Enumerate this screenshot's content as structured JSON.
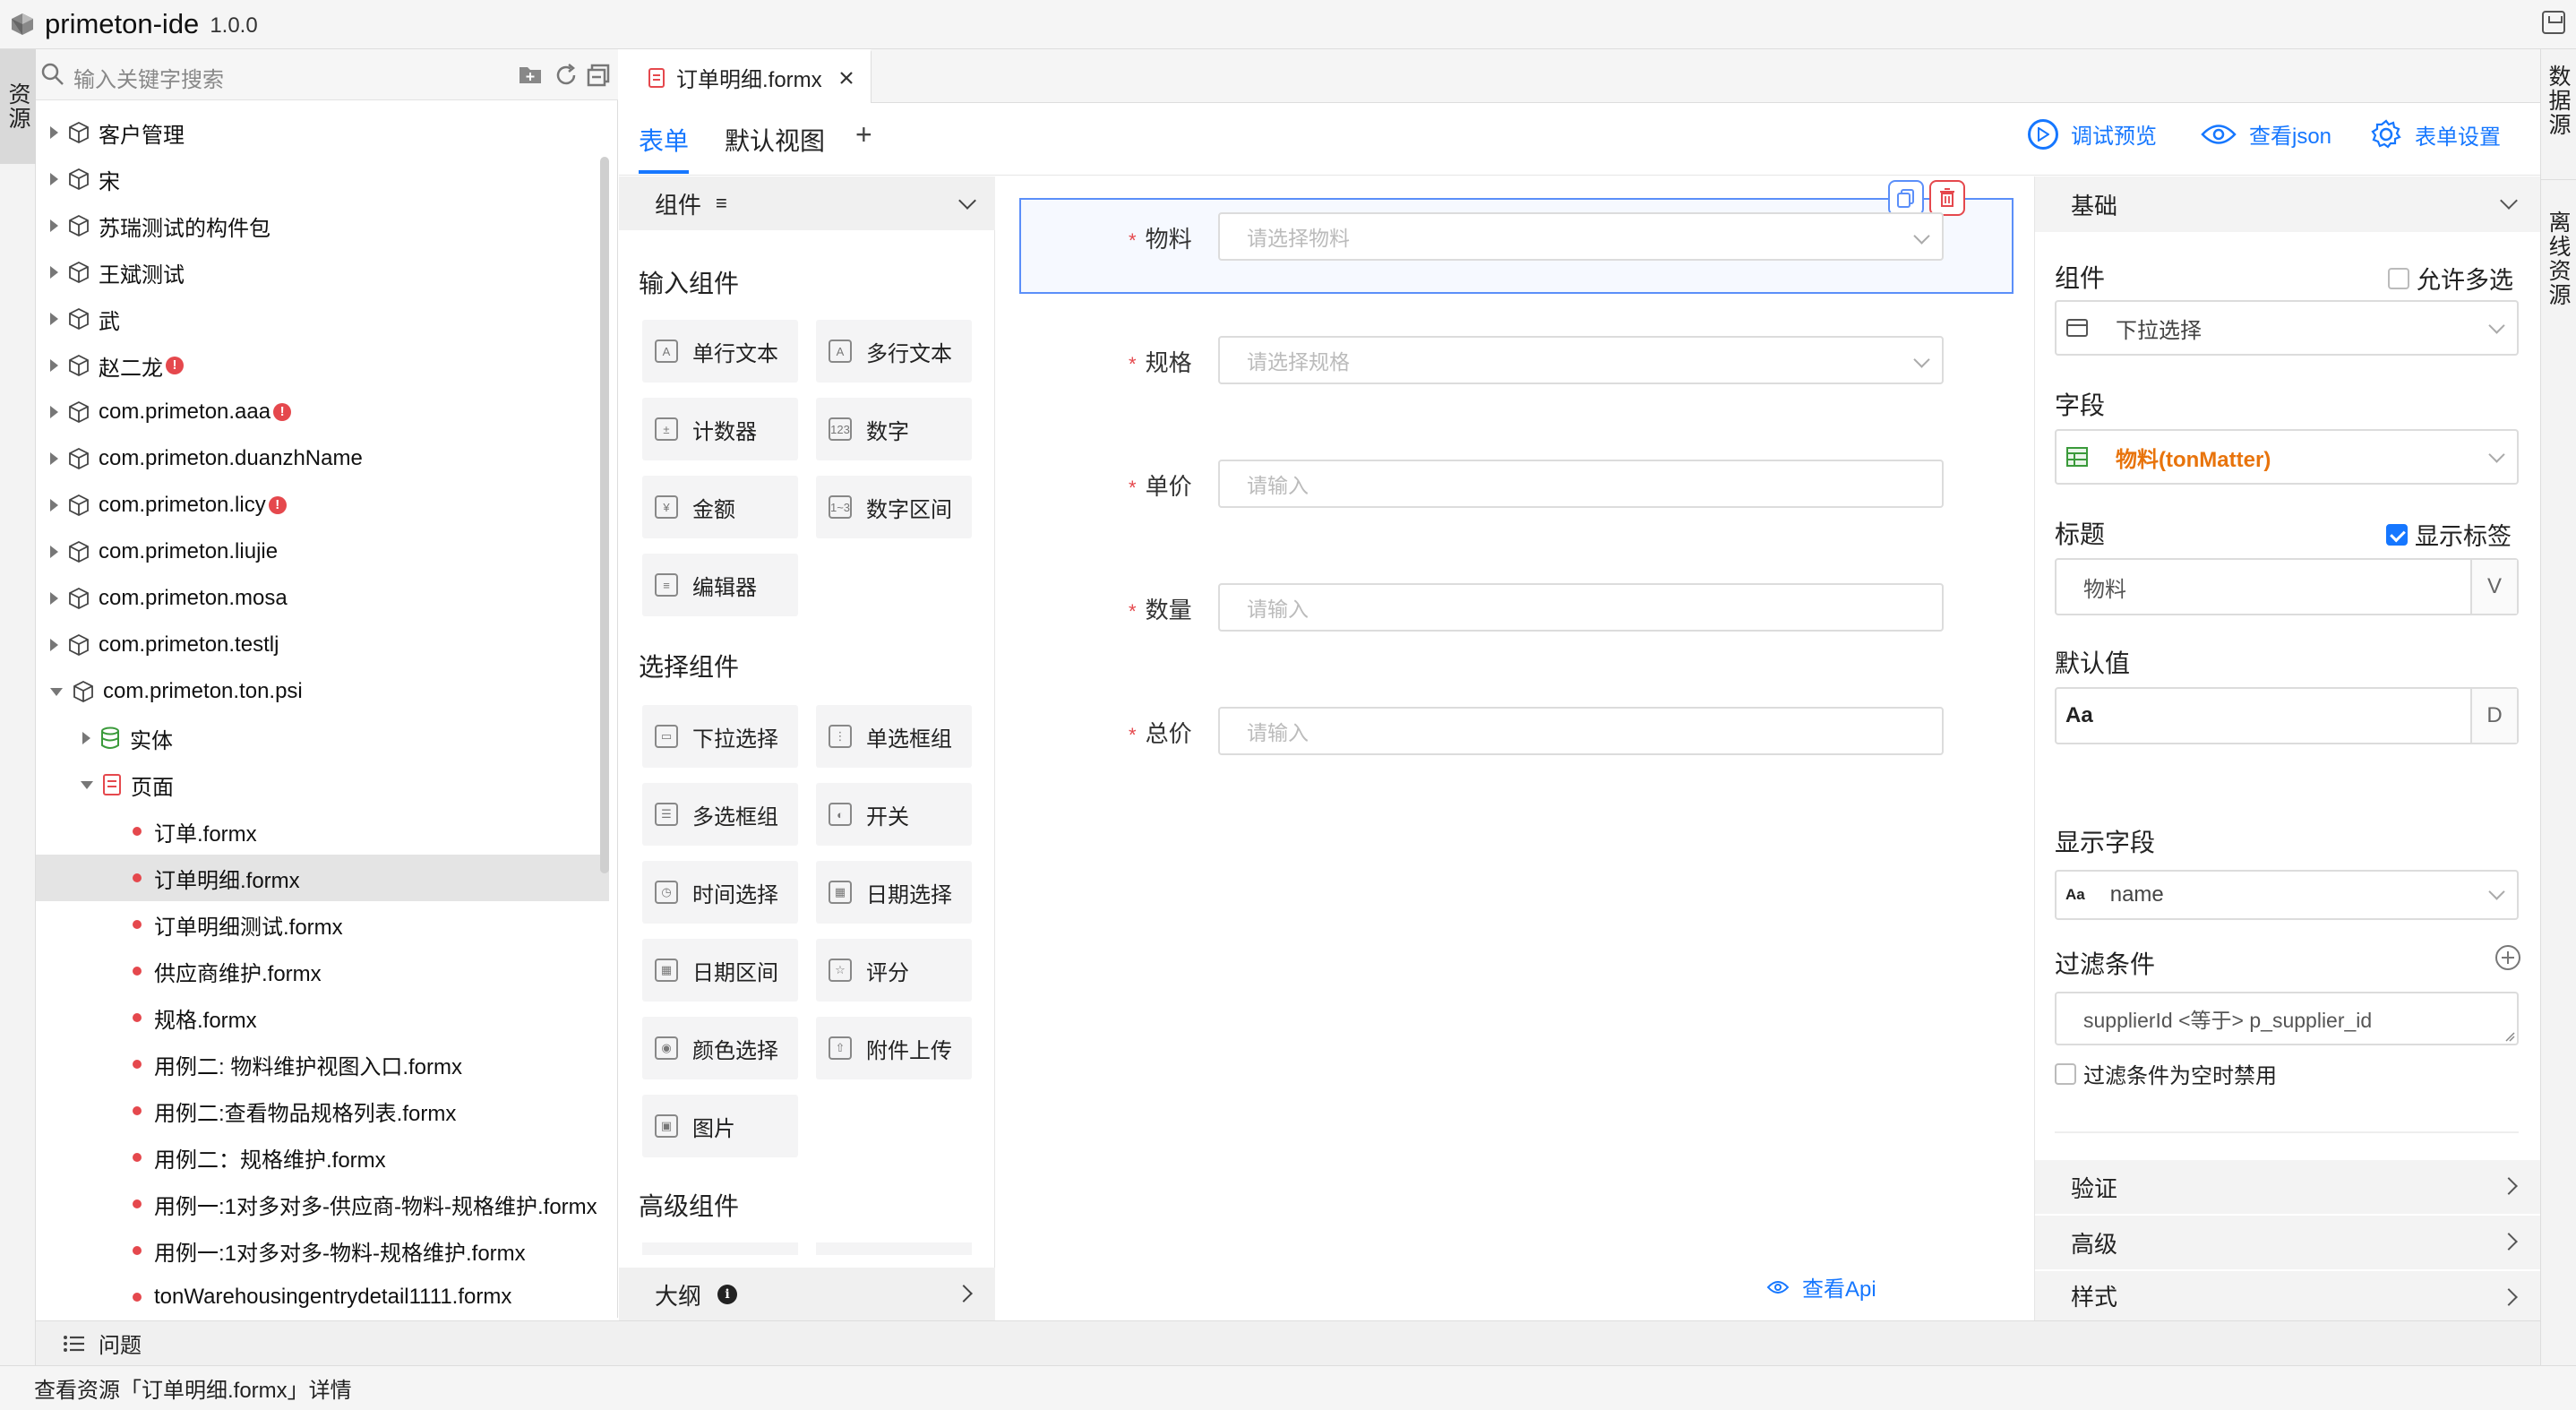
{
  "app": {
    "title": "primeton-ide",
    "version": "1.0.0"
  },
  "activity": {
    "left_tab": "资源",
    "right_tabs": [
      "数据源",
      "离线资源"
    ]
  },
  "explorer": {
    "search_placeholder": "输入关键字搜索",
    "items": [
      {
        "label": "客户管理",
        "badge": ""
      },
      {
        "label": "宋",
        "badge": ""
      },
      {
        "label": "苏瑞测试的构件包",
        "badge": ""
      },
      {
        "label": "王斌测试",
        "badge": ""
      },
      {
        "label": "武",
        "badge": ""
      },
      {
        "label": "赵二龙",
        "badge": "!"
      },
      {
        "label": "com.primeton.aaa",
        "badge": "!"
      },
      {
        "label": "com.primeton.duanzhName",
        "badge": ""
      },
      {
        "label": "com.primeton.licy",
        "badge": "!"
      },
      {
        "label": "com.primeton.liujie",
        "badge": ""
      },
      {
        "label": "com.primeton.mosa",
        "badge": ""
      },
      {
        "label": "com.primeton.testlj",
        "badge": ""
      },
      {
        "label": "com.primeton.ton.psi",
        "badge": ""
      }
    ],
    "sub_entity": "实体",
    "sub_page": "页面",
    "files": [
      "订单.formx",
      "订单明细.formx",
      "订单明细测试.formx",
      "供应商维护.formx",
      "规格.formx",
      "用例二: 物料维护视图入口.formx",
      "用例二:查看物品规格列表.formx",
      "用例二：规格维护.formx",
      "用例一:1对多对多-供应商-物料-规格维护.formx",
      "用例一:1对多对多-物料-规格维护.formx",
      "tonWarehousingentrydetail1111.formx"
    ],
    "selected_file": "订单明细.formx"
  },
  "editor": {
    "tab_label": "订单明细.formx",
    "form_tabs": [
      "表单",
      "默认视图"
    ],
    "add_tab": "+",
    "tools": {
      "preview": "调试预览",
      "json": "查看json",
      "settings": "表单设置"
    }
  },
  "palette": {
    "header": "组件",
    "header_icon": "≡",
    "sections": {
      "input": "输入组件",
      "select": "选择组件",
      "advanced": "高级组件"
    },
    "input_items": [
      "单行文本",
      "多行文本",
      "计数器",
      "数字",
      "金额",
      "数字区间",
      "编辑器"
    ],
    "select_items": [
      "下拉选择",
      "单选框组",
      "多选框组",
      "开关",
      "时间选择",
      "日期选择",
      "日期区间",
      "评分",
      "颜色选择",
      "附件上传",
      "图片"
    ],
    "outline": "大纲",
    "outline_info": "i"
  },
  "canvas": {
    "fields": [
      {
        "label": "物料",
        "placeholder": "请选择物料",
        "type": "select"
      },
      {
        "label": "规格",
        "placeholder": "请选择规格",
        "type": "select"
      },
      {
        "label": "单价",
        "placeholder": "请输入",
        "type": "input"
      },
      {
        "label": "数量",
        "placeholder": "请输入",
        "type": "input"
      },
      {
        "label": "总价",
        "placeholder": "请输入",
        "type": "input"
      }
    ],
    "required_mark": "*",
    "view_api": "查看Api"
  },
  "props": {
    "basic": "基础",
    "component_label": "组件",
    "allow_multi": "允许多选",
    "component_value": "下拉选择",
    "field_label": "字段",
    "field_value": "物料(tonMatter)",
    "title_label": "标题",
    "show_label": "显示标签",
    "title_value": "物料",
    "title_suffix": "V",
    "default_label": "默认值",
    "default_value": "Aa",
    "default_suffix": "D",
    "display_field_label": "显示字段",
    "display_field_prefix": "Aa",
    "display_field_value": "name",
    "filter_label": "过滤条件",
    "filter_value": "supplierId <等于> p_supplier_id",
    "filter_disable": "过滤条件为空时禁用",
    "sections": [
      "验证",
      "高级",
      "样式"
    ]
  },
  "bottom": {
    "problems": "问题",
    "status": "查看资源「订单明细.formx」详情"
  },
  "colors": {
    "accent": "#1677ff",
    "error": "#e5484d",
    "field_orange": "#e8740c"
  }
}
